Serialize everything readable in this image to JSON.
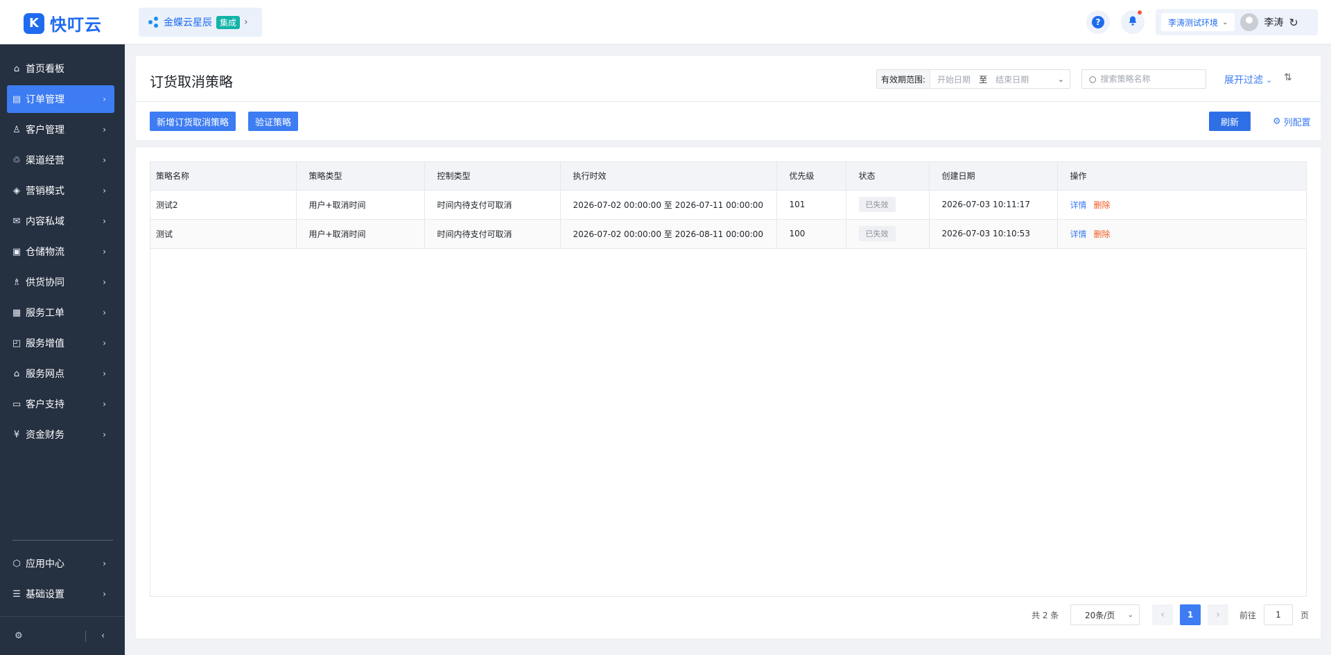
{
  "app": {
    "logo_mark": "K",
    "name": "快叮云"
  },
  "brand": {
    "name": "金蝶云星辰",
    "tag": "集成"
  },
  "header": {
    "help_icon": "?",
    "environment": "李涛测试环境",
    "user_name": "李涛"
  },
  "sidebar": {
    "items": [
      {
        "label": "首页看板",
        "icon": "home-icon"
      },
      {
        "label": "订单管理",
        "icon": "order-icon",
        "active": true
      },
      {
        "label": "客户管理",
        "icon": "user-icon"
      },
      {
        "label": "渠道经营",
        "icon": "channel-icon"
      },
      {
        "label": "营销模式",
        "icon": "tag-icon"
      },
      {
        "label": "内容私域",
        "icon": "mail-icon"
      },
      {
        "label": "仓储物流",
        "icon": "box-icon"
      },
      {
        "label": "供货协同",
        "icon": "supplier-icon"
      },
      {
        "label": "服务工单",
        "icon": "ticket-icon"
      },
      {
        "label": "服务增值",
        "icon": "bag-icon"
      },
      {
        "label": "服务网点",
        "icon": "store-icon"
      },
      {
        "label": "客户支持",
        "icon": "support-icon"
      },
      {
        "label": "资金财务",
        "icon": "money-icon"
      }
    ],
    "bottom_items": [
      {
        "label": "应用中心",
        "icon": "app-icon"
      },
      {
        "label": "基础设置",
        "icon": "settings-list-icon"
      }
    ]
  },
  "page": {
    "title": "订货取消策略",
    "filter": {
      "date_label": "有效期范围:",
      "start_placeholder": "开始日期",
      "to": "至",
      "end_placeholder": "结束日期",
      "search_placeholder": "搜索策略名称",
      "expand_filter": "展开过滤"
    },
    "actions": {
      "add": "新增订货取消策略",
      "verify": "验证策略",
      "refresh": "刷新",
      "column_config": "列配置"
    }
  },
  "table": {
    "columns": [
      "策略名称",
      "策略类型",
      "控制类型",
      "执行时效",
      "优先级",
      "状态",
      "创建日期",
      "操作"
    ],
    "rows": [
      {
        "name": "测试2",
        "type": "用户+取消时间",
        "control": "时间内待支付可取消",
        "period": "2026-07-02 00:00:00 至 2026-07-11 00:00:00",
        "priority": "101",
        "status": "已失效",
        "created": "2026-07-03 10:11:17",
        "op_detail": "详情",
        "op_delete": "删除"
      },
      {
        "name": "测试",
        "type": "用户+取消时间",
        "control": "时间内待支付可取消",
        "period": "2026-07-02 00:00:00 至 2026-08-11 00:00:00",
        "priority": "100",
        "status": "已失效",
        "created": "2026-07-03 10:10:53",
        "op_detail": "详情",
        "op_delete": "删除"
      }
    ]
  },
  "pagination": {
    "total": "共 2 条",
    "page_size": "20条/页",
    "current_page": "1",
    "goto_label": "前往",
    "goto_value": "1",
    "page_suffix": "页"
  },
  "colors": {
    "primary": "#3d7cf2",
    "sidebar_bg": "#253041",
    "danger": "#f05a1e"
  }
}
